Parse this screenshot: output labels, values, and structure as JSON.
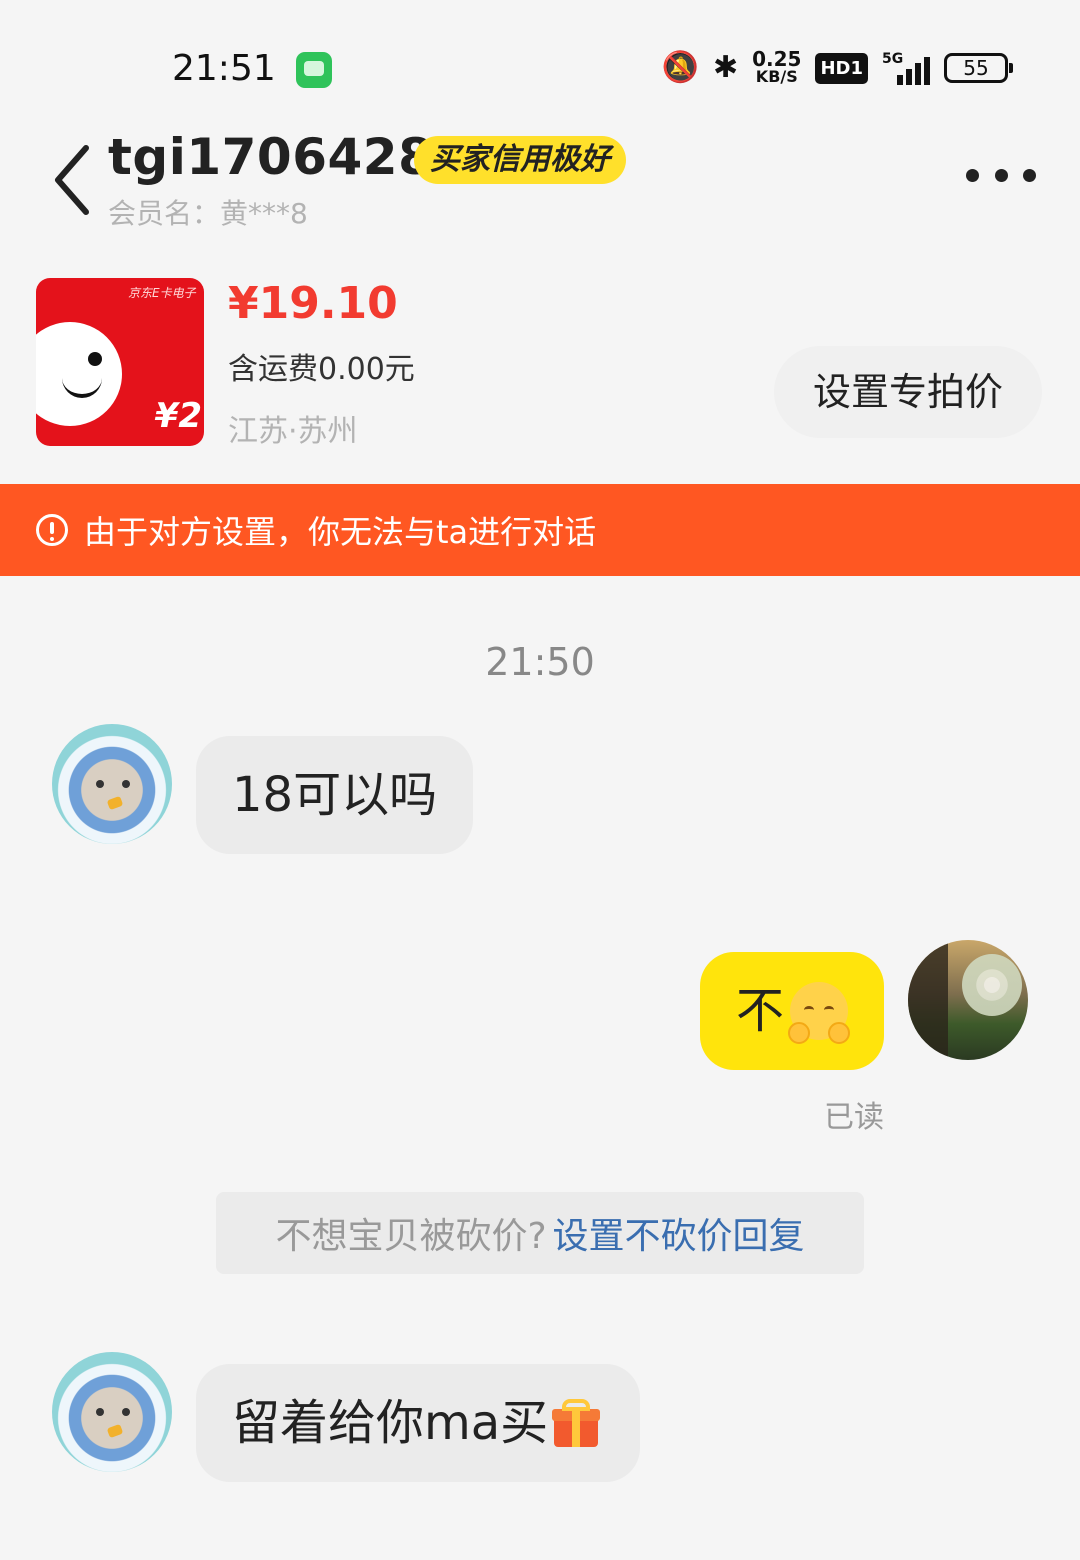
{
  "status_bar": {
    "time": "21:51",
    "net_speed_value": "0.25",
    "net_speed_unit": "KB/S",
    "hd_label": "HD1",
    "network_label": "5G",
    "battery": "55",
    "icons": [
      "messages-app-icon",
      "mute-vibrate-icon",
      "bluetooth-icon",
      "signal-icon",
      "battery-icon"
    ]
  },
  "header": {
    "user_name": "tgi17064286",
    "credit_badge": "买家信用极好",
    "member_name": "会员名：黄***8"
  },
  "product": {
    "image_brand_text": "京东E卡电子",
    "image_face_value": "¥2",
    "price": "¥19.10",
    "shipping": "含运费0.00元",
    "location": "江苏·苏州",
    "special_price_button": "设置专拍价"
  },
  "warning": {
    "text": "由于对方设置，你无法与ta进行对话"
  },
  "chat": {
    "timestamp": "21:50",
    "messages": [
      {
        "from": "buyer",
        "text": "18可以吗"
      },
      {
        "from": "me",
        "text": "不",
        "emoji": "shy-face-emoji"
      },
      {
        "from": "buyer",
        "text": "留着给你ma买",
        "emoji": "gift-emoji"
      }
    ],
    "read_label": "已读",
    "bargain_tip": {
      "question": "不想宝贝被砍价?",
      "link": "设置不砍价回复"
    }
  },
  "colors": {
    "accent_yellow": "#ffe40c",
    "price_red": "#f23b30",
    "warning_orange": "#ff5722",
    "link_blue": "#3a6eb0"
  }
}
